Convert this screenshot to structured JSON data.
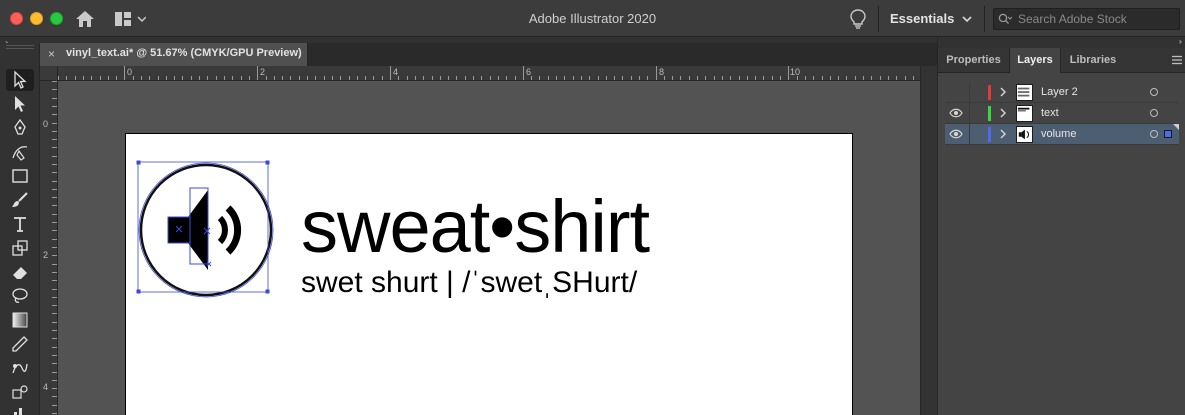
{
  "window": {
    "title": "Adobe Illustrator 2020",
    "workspace": "Essentials",
    "search_placeholder": "Search Adobe Stock"
  },
  "document": {
    "tab_label": "vinyl_text.ai* @ 51.67% (CMYK/GPU Preview)",
    "close_glyph": "×"
  },
  "rulers": {
    "top": [
      "0",
      "2",
      "4",
      "6",
      "8",
      "10"
    ],
    "left": [
      "0",
      "2",
      "4"
    ]
  },
  "artboard": {
    "word": "sweat•shirt",
    "pronunciation": "swet shurt | /ˈswetˌSHurt/"
  },
  "panel": {
    "tabs": [
      "Properties",
      "Layers",
      "Libraries"
    ],
    "active_tab": "Layers",
    "layers": [
      {
        "name": "Layer 2",
        "color": "#e03a3a",
        "visible": false,
        "selected": false
      },
      {
        "name": "text",
        "color": "#3ad83a",
        "visible": true,
        "selected": false
      },
      {
        "name": "volume",
        "color": "#4f6cf0",
        "visible": true,
        "selected": true
      }
    ]
  },
  "icons": {
    "home": "home-icon",
    "workspace_switcher": "grid-layout-icon",
    "bulb": "lightbulb-icon",
    "search": "search-icon"
  }
}
